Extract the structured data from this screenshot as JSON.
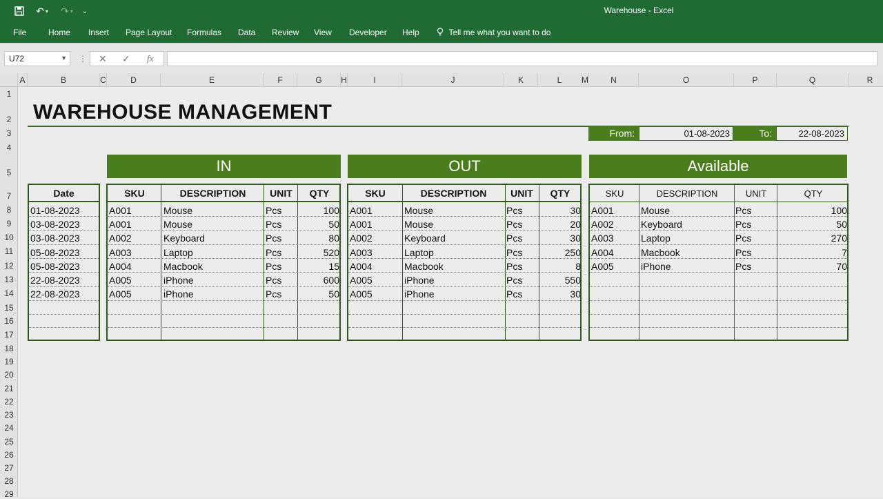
{
  "window": {
    "title": "Warehouse  -  Excel"
  },
  "ribbon": {
    "tabs": [
      "File",
      "Home",
      "Insert",
      "Page Layout",
      "Formulas",
      "Data",
      "Review",
      "View",
      "Developer",
      "Help"
    ],
    "tell_me": "Tell me what you want to do"
  },
  "formula_bar": {
    "name_box": "U72",
    "fx": "fx",
    "formula": ""
  },
  "columns": [
    "A",
    "B",
    "C",
    "D",
    "E",
    "F",
    "G",
    "H",
    "I",
    "J",
    "K",
    "L",
    "M",
    "N",
    "O",
    "P",
    "Q",
    "R"
  ],
  "rows": [
    "1",
    "2",
    "3",
    "4",
    "5",
    "7",
    "8",
    "9",
    "10",
    "11",
    "12",
    "13",
    "14",
    "15",
    "16",
    "17",
    "18",
    "19",
    "20",
    "21",
    "22",
    "23",
    "24",
    "25",
    "26",
    "27",
    "28",
    "29"
  ],
  "sheet": {
    "title": "WAREHOUSE MANAGEMENT",
    "from_label": "From:",
    "from_value": "01-08-2023",
    "to_label": "To:",
    "to_value": "22-08-2023"
  },
  "date_table": {
    "header": "Date",
    "values": [
      "01-08-2023",
      "03-08-2023",
      "03-08-2023",
      "05-08-2023",
      "05-08-2023",
      "22-08-2023",
      "22-08-2023"
    ]
  },
  "in_table": {
    "banner": "IN",
    "headers": [
      "SKU",
      "DESCRIPTION",
      "UNIT",
      "QTY"
    ],
    "rows": [
      [
        "A001",
        "Mouse",
        "Pcs",
        "100"
      ],
      [
        "A001",
        "Mouse",
        "Pcs",
        "50"
      ],
      [
        "A002",
        "Keyboard",
        "Pcs",
        "80"
      ],
      [
        "A003",
        "Laptop",
        "Pcs",
        "520"
      ],
      [
        "A004",
        "Macbook",
        "Pcs",
        "15"
      ],
      [
        "A005",
        "iPhone",
        "Pcs",
        "600"
      ],
      [
        "A005",
        "iPhone",
        "Pcs",
        "50"
      ]
    ]
  },
  "out_table": {
    "banner": "OUT",
    "headers": [
      "SKU",
      "DESCRIPTION",
      "UNIT",
      "QTY"
    ],
    "rows": [
      [
        "A001",
        "Mouse",
        "Pcs",
        "30"
      ],
      [
        "A001",
        "Mouse",
        "Pcs",
        "20"
      ],
      [
        "A002",
        "Keyboard",
        "Pcs",
        "30"
      ],
      [
        "A003",
        "Laptop",
        "Pcs",
        "250"
      ],
      [
        "A004",
        "Macbook",
        "Pcs",
        "8"
      ],
      [
        "A005",
        "iPhone",
        "Pcs",
        "550"
      ],
      [
        "A005",
        "iPhone",
        "Pcs",
        "30"
      ]
    ]
  },
  "available_table": {
    "banner": "Available",
    "headers": [
      "SKU",
      "DESCRIPTION",
      "UNIT",
      "QTY"
    ],
    "rows": [
      [
        "A001",
        "Mouse",
        "Pcs",
        "100"
      ],
      [
        "A002",
        "Keyboard",
        "Pcs",
        "50"
      ],
      [
        "A003",
        "Laptop",
        "Pcs",
        "270"
      ],
      [
        "A004",
        "Macbook",
        "Pcs",
        "7"
      ],
      [
        "A005",
        "iPhone",
        "Pcs",
        "70"
      ]
    ]
  },
  "colors": {
    "ribbon": "#1f6b33",
    "accent": "#4a7d1c",
    "border": "#2f5a17"
  }
}
